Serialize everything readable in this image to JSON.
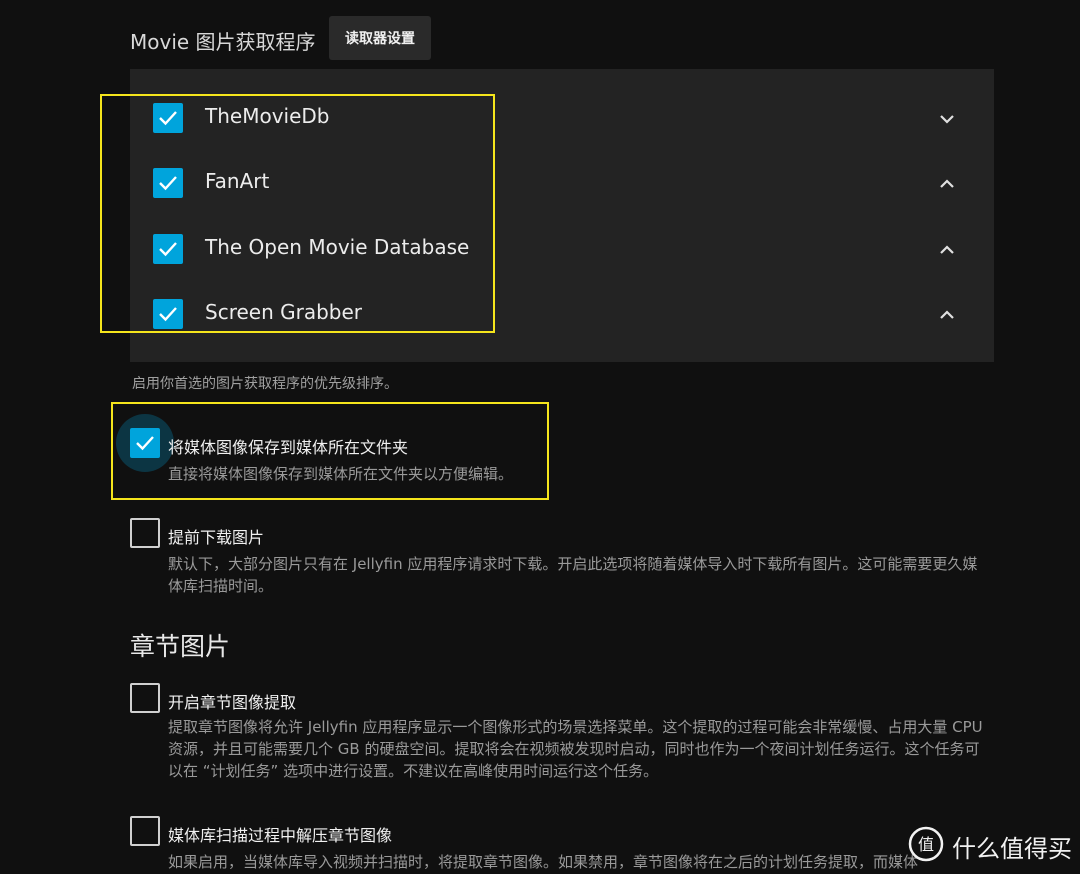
{
  "header": {
    "title": "Movie 图片获取程序",
    "reader_settings_label": "读取器设置"
  },
  "fetchers": [
    {
      "name": "TheMovieDb",
      "checked": true,
      "chevron": "chevron-down-icon"
    },
    {
      "name": "FanArt",
      "checked": true,
      "chevron": "chevron-up-icon"
    },
    {
      "name": "The Open Movie Database",
      "checked": true,
      "chevron": "chevron-up-icon"
    },
    {
      "name": "Screen Grabber",
      "checked": true,
      "chevron": "chevron-up-icon"
    }
  ],
  "fetcher_helper": "启用你首选的图片获取程序的优先级排序。",
  "options": {
    "save_local": {
      "label": "将媒体图像保存到媒体所在文件夹",
      "desc": "直接将媒体图像保存到媒体所在文件夹以方便编辑。",
      "checked": true
    },
    "download_images": {
      "label": "提前下载图片",
      "desc": "默认下，大部分图片只有在 Jellyfin 应用程序请求时下载。开启此选项将随着媒体导入时下载所有图片。这可能需要更久媒体库扫描时间。",
      "checked": false
    }
  },
  "chapter": {
    "title": "章节图片",
    "extract": {
      "label": "开启章节图像提取",
      "desc": "提取章节图像将允许 Jellyfin 应用程序显示一个图像形式的场景选择菜单。这个提取的过程可能会非常缓慢、占用大量 CPU 资源，并且可能需要几个 GB 的硬盘空间。提取将会在视频被发现时启动，同时也作为一个夜间计划任务运行。这个任务可以在 “计划任务” 选项中进行设置。不建议在高峰使用时间运行这个任务。",
      "checked": false
    },
    "during_scan": {
      "label": "媒体库扫描过程中解压章节图像",
      "desc": "如果启用，当媒体库导入视频并扫描时，将提取章节图像。如果禁用，章节图像将在之后的计划任务提取，而媒体",
      "checked": false
    }
  },
  "watermark": {
    "icon": "smzdm-logo-icon",
    "text": "什么值得买"
  },
  "colors": {
    "accent": "#00a4dc",
    "highlight": "#f5e51c",
    "background": "#101010",
    "panel": "#232323"
  }
}
